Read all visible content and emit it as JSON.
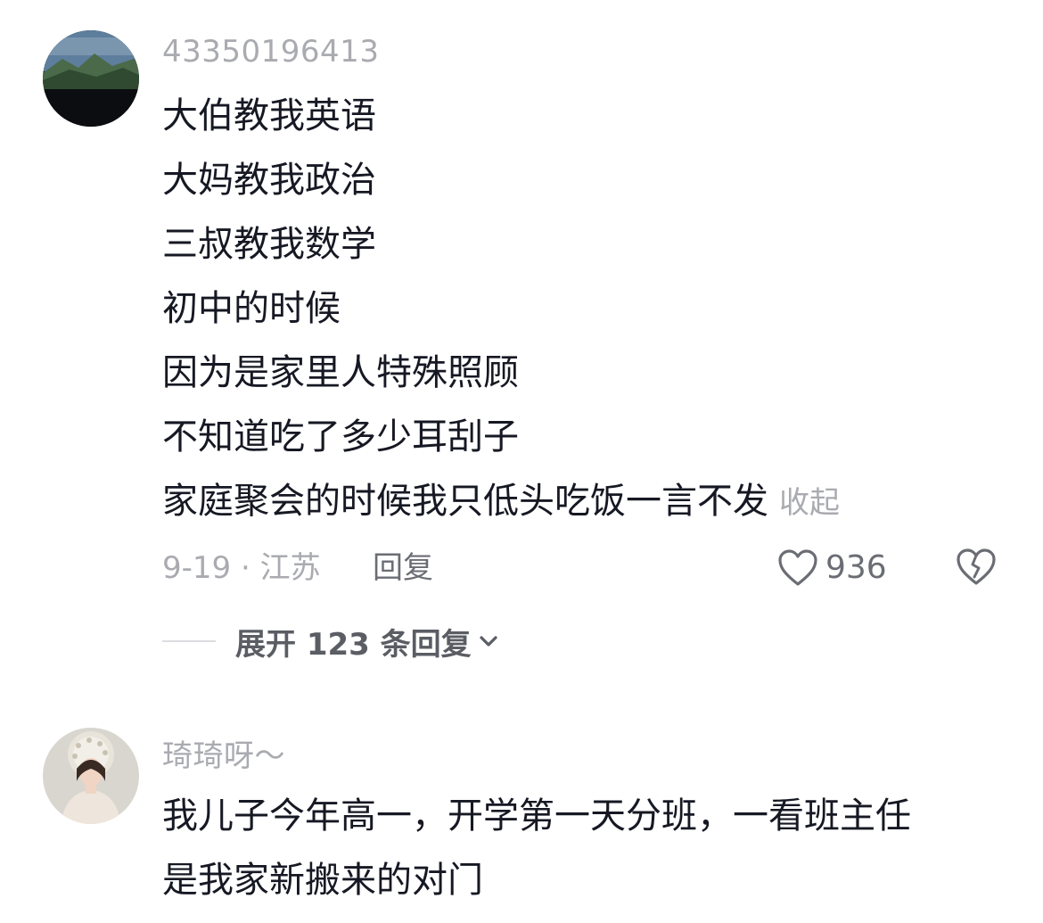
{
  "comments": [
    {
      "username": "43350196413",
      "lines": [
        "大伯教我英语",
        "大妈教我政治",
        "三叔教我数学",
        "初中的时候",
        "因为是家里人特殊照顾",
        "不知道吃了多少耳刮子",
        "家庭聚会的时候我只低头吃饭一言不发"
      ],
      "collapse_label": "收起",
      "date_location": "9-19 · 江苏",
      "reply_label": "回复",
      "like_count": "936",
      "expand_replies_label": "展开 123 条回复",
      "avatar_icon": "mountain-landscape"
    },
    {
      "username": "琦琦呀～",
      "lines": [
        "我儿子今年高一，开学第一天分班，一看班主任",
        "是我家新搬来的对门"
      ],
      "avatar_icon": "woman-portrait"
    }
  ],
  "colors": {
    "primary_text": "#161823",
    "secondary_text": "#a9abb0",
    "action_text": "#6b6d74"
  }
}
